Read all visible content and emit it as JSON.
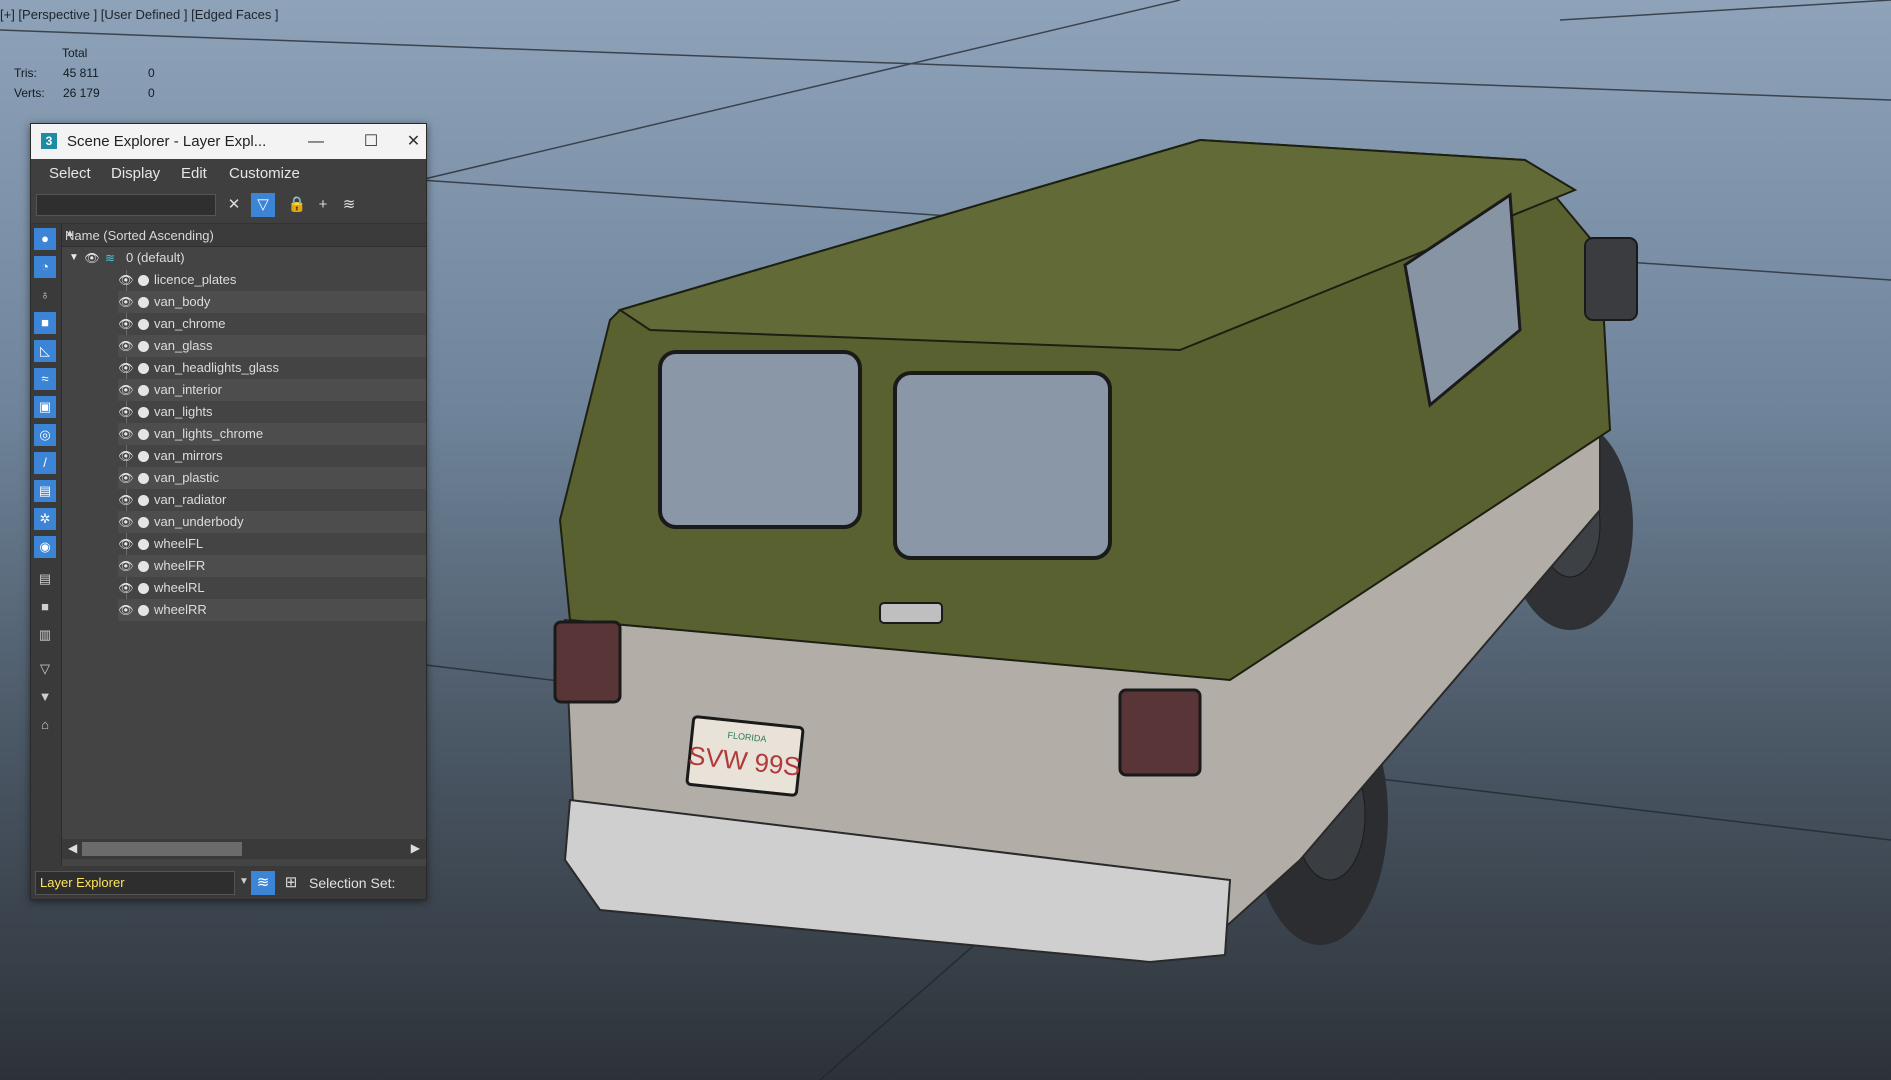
{
  "viewport": {
    "label": "[+] [Perspective ] [User Defined ] [Edged Faces ]",
    "stats": {
      "total_label": "Total",
      "rows": [
        {
          "label": "Tris:",
          "total": "45 811",
          "sel": "0"
        },
        {
          "label": "Verts:",
          "total": "26 179",
          "sel": "0"
        }
      ]
    },
    "license_plate": {
      "text": "SVW 99S",
      "state": "FLORIDA"
    },
    "colors": {
      "sky_top": "#8ea3b9",
      "ground": "#2d3238",
      "van_upper": "#5a6131",
      "van_lower": "#b6b2ab"
    }
  },
  "scene_explorer": {
    "title": "Scene Explorer - Layer Expl...",
    "app_icon": "3",
    "window_buttons": {
      "minimize": "—",
      "maximize": "☐",
      "close": "✕"
    },
    "menu": [
      "Select",
      "Display",
      "Edit",
      "Customize"
    ],
    "search": {
      "value": "",
      "placeholder": ""
    },
    "toolbar_icons": [
      "clear-x-icon",
      "filter-icon",
      "lock-icon",
      "add-layer-icon",
      "layers-icon"
    ],
    "column_header": "Name (Sorted Ascending)",
    "root": {
      "label": "0 (default)"
    },
    "items": [
      "licence_plates",
      "van_body",
      "van_chrome",
      "van_glass",
      "van_headlights_glass",
      "van_interior",
      "van_lights",
      "van_lights_chrome",
      "van_mirrors",
      "van_plastic",
      "van_radiator",
      "van_underbody",
      "wheelFL",
      "wheelFR",
      "wheelRL",
      "wheelRR"
    ],
    "left_icons": [
      "geometry-icon",
      "shapes-icon",
      "lights-icon",
      "cameras-icon",
      "helpers-icon",
      "spacewarps-icon",
      "groups-icon",
      "xrefs-icon",
      "bones-icon",
      "containers-icon",
      "frozen-icon",
      "hidden-icon",
      "display-all-icon",
      "display-none-icon",
      "invert-icon",
      "filter-dim-icon",
      "filter-icon",
      "find-icon"
    ],
    "bottom": {
      "dropdown_value": "Layer Explorer",
      "selection_set_label": "Selection Set:"
    }
  }
}
